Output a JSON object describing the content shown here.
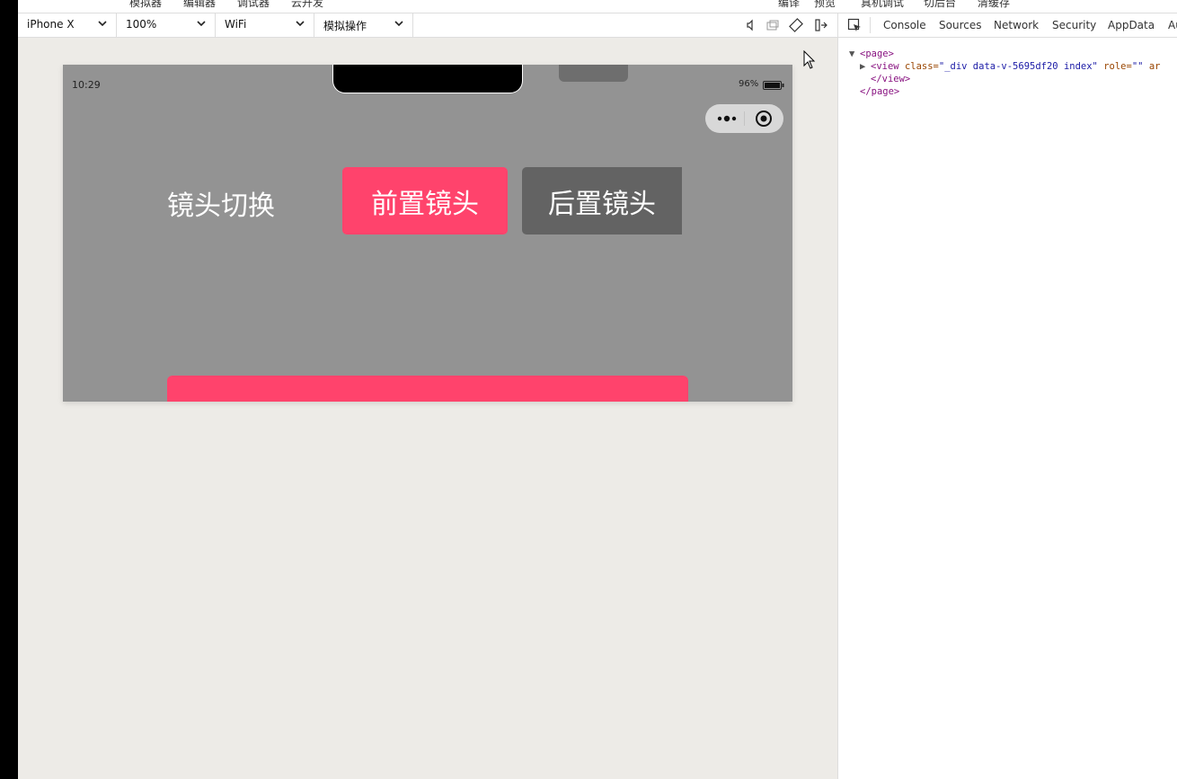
{
  "top_menu": [
    "模拟器",
    "编辑器",
    "调试器",
    "云开发",
    "编译",
    "预览",
    "真机调试",
    "切后台",
    "清缓存"
  ],
  "toolbar": {
    "device": "iPhone X",
    "zoom": "100%",
    "network": "WiFi",
    "operation": "模拟操作"
  },
  "devtools": {
    "tabs": [
      "Console",
      "Sources",
      "Network",
      "Security",
      "AppData",
      "Au"
    ],
    "tree": {
      "page_open": "<page>",
      "view_tag": "<view",
      "class_attr": "class=",
      "class_val": "\"_div data-v-5695df20 index\"",
      "role_attr": "role=",
      "role_val": "\"\"",
      "extra": "ar",
      "view_close": "</view>",
      "page_close": "</page>"
    }
  },
  "phone": {
    "time": "10:29",
    "battery": "96%",
    "lens_label": "镜头切换",
    "front_button": "前置镜头",
    "rear_button": "后置镜头"
  },
  "colors": {
    "accent_pink": "#ff436c",
    "rear_gray": "#636363",
    "screen_gray": "#939393",
    "canvas_bg": "#edebe7"
  },
  "icons": [
    "chevron-down-icon",
    "volume-icon",
    "window-icon",
    "rotate-icon",
    "dock-icon",
    "inspect-icon",
    "more-icon",
    "target-icon",
    "battery-icon",
    "cursor-icon"
  ]
}
